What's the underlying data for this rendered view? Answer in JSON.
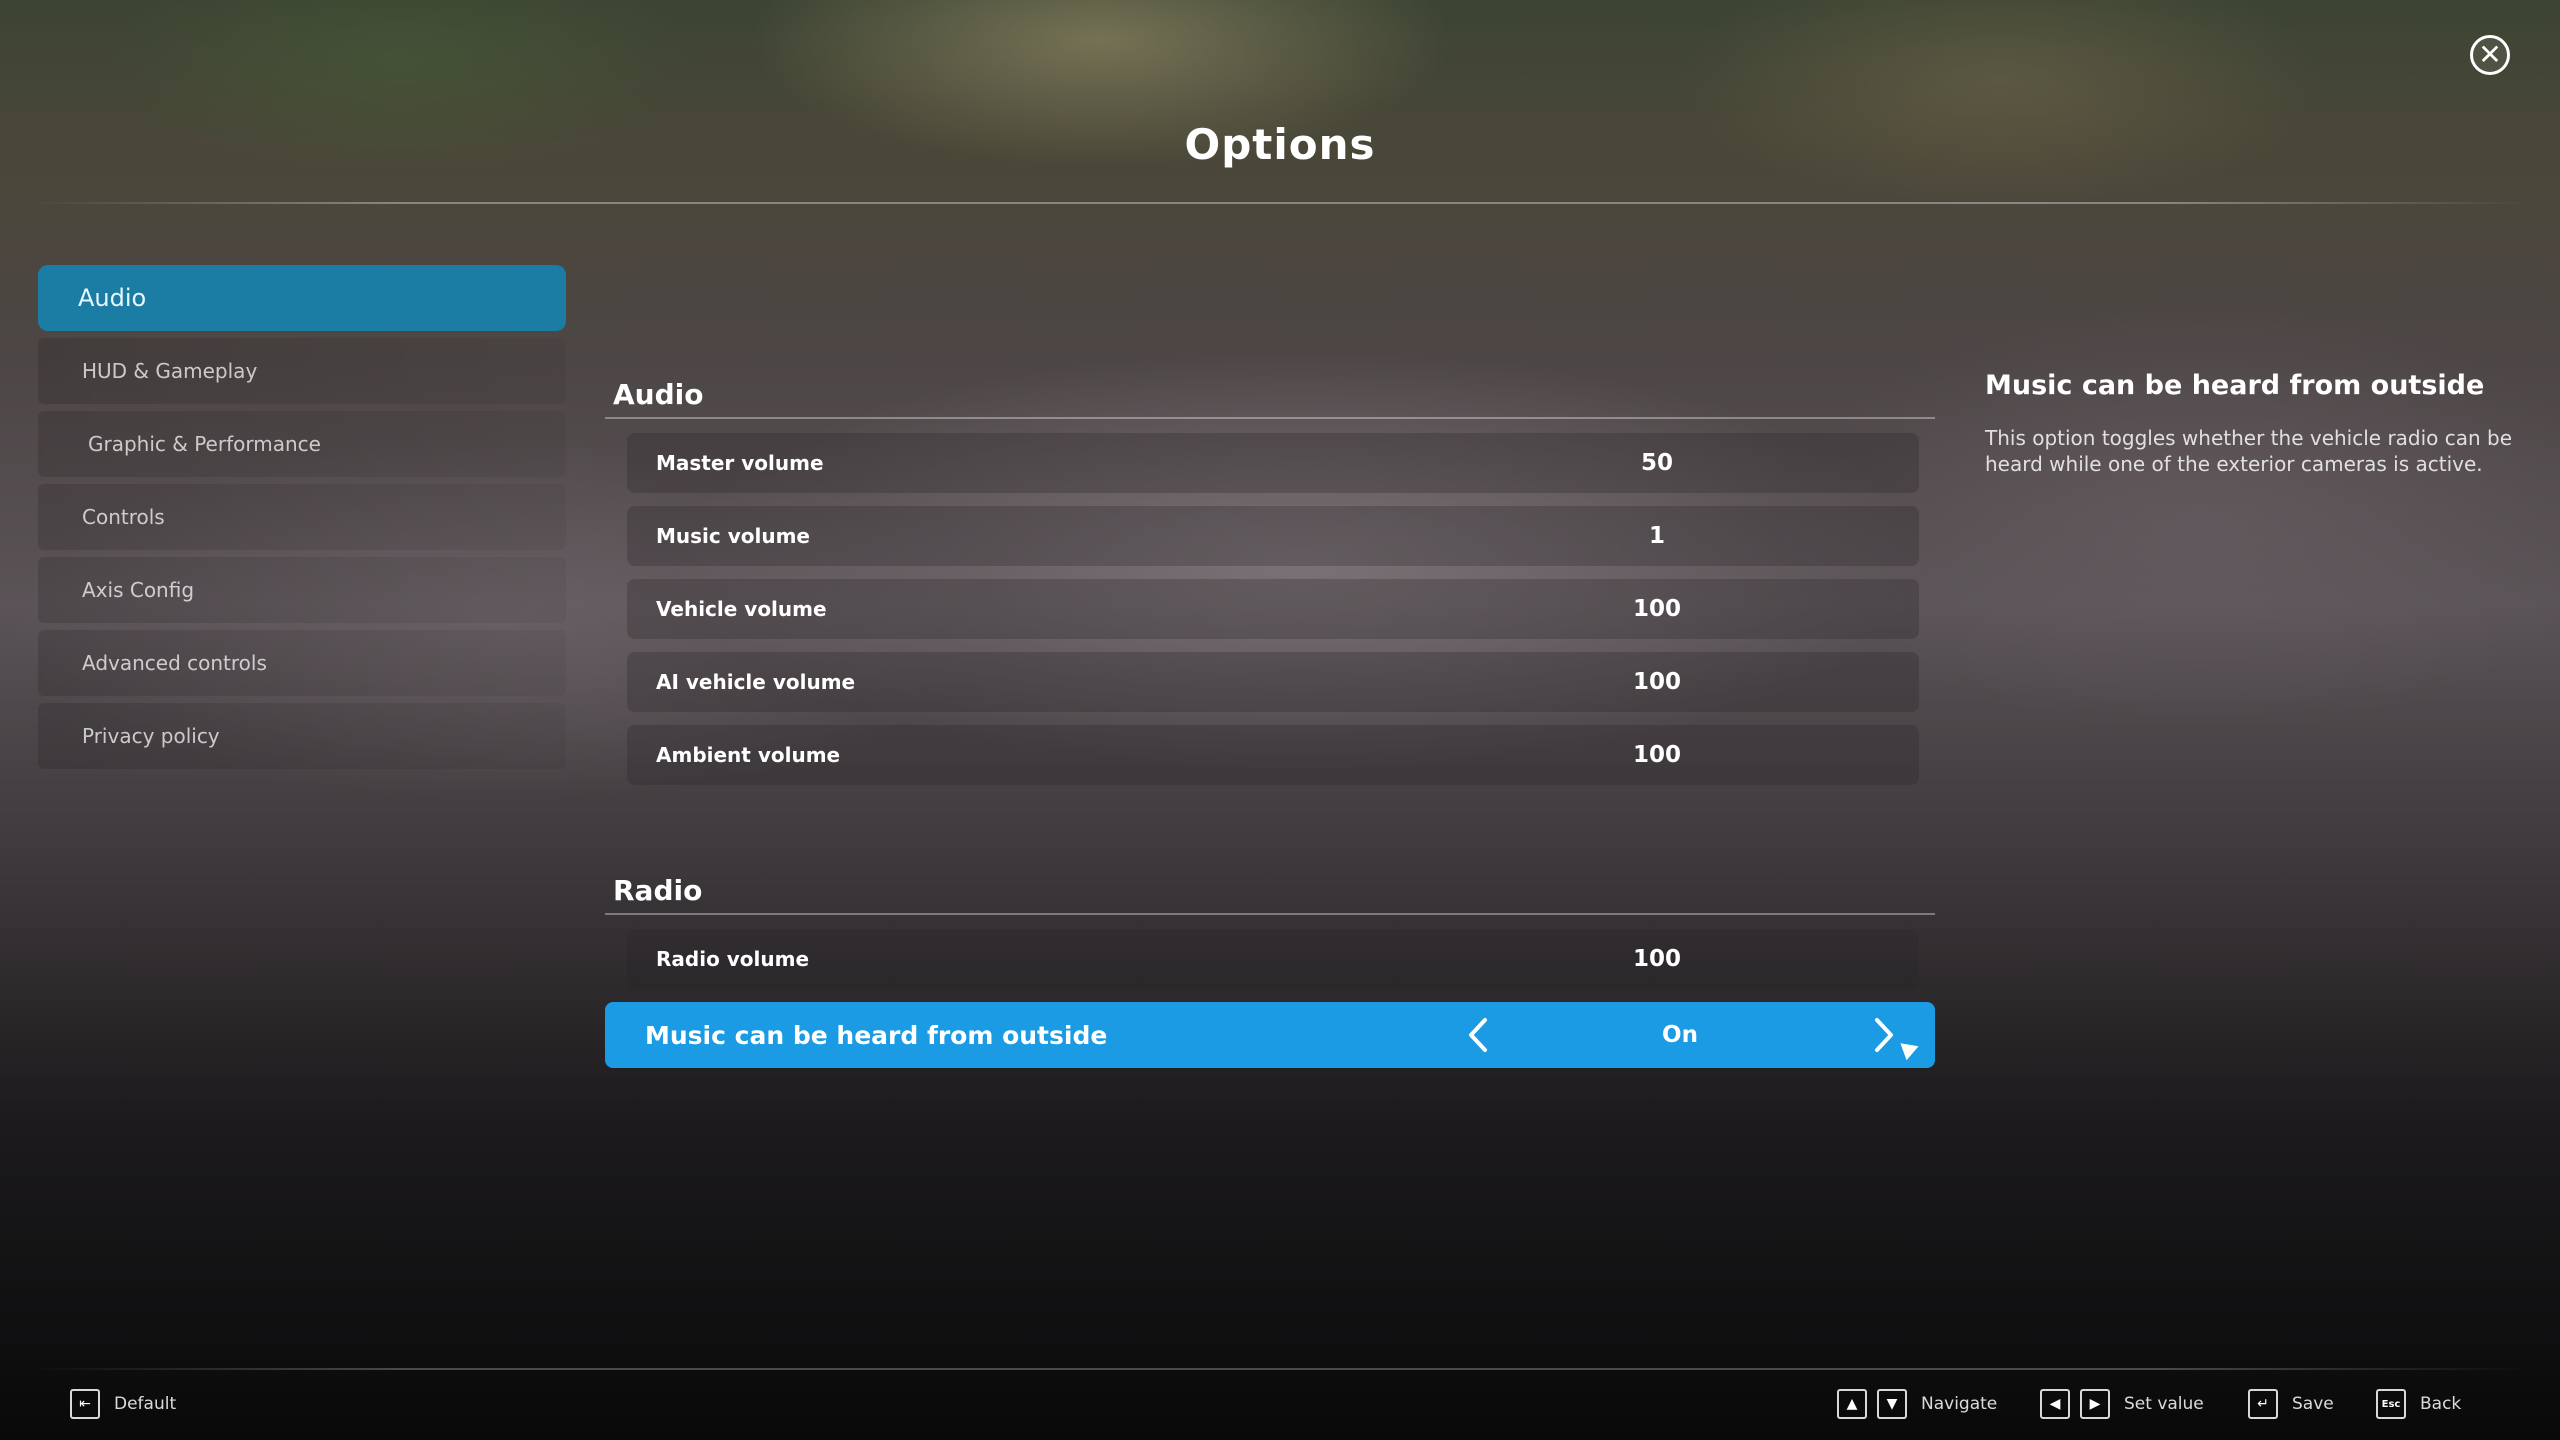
{
  "header": {
    "title": "Options"
  },
  "sidebar": {
    "items": [
      {
        "label": "Audio",
        "active": true
      },
      {
        "label": "HUD & Gameplay"
      },
      {
        "label": "Graphic & Performance"
      },
      {
        "label": "Controls"
      },
      {
        "label": "Axis Config"
      },
      {
        "label": "Advanced controls"
      },
      {
        "label": "Privacy policy"
      }
    ]
  },
  "sections": {
    "audio": {
      "title": "Audio",
      "rows": [
        {
          "label": "Master volume",
          "value": "50"
        },
        {
          "label": "Music volume",
          "value": "1"
        },
        {
          "label": "Vehicle volume",
          "value": "100"
        },
        {
          "label": "AI vehicle volume",
          "value": "100"
        },
        {
          "label": "Ambient volume",
          "value": "100"
        }
      ]
    },
    "radio": {
      "title": "Radio",
      "rows": [
        {
          "label": "Radio volume",
          "value": "100"
        },
        {
          "label": "Music can be heard from outside",
          "value": "On",
          "selected": true
        }
      ]
    }
  },
  "description": {
    "title": "Music can be heard from outside",
    "text": "This option toggles whether the vehicle radio can be heard while one of the exterior cameras is active."
  },
  "footer": {
    "default_label": "Default",
    "navigate_label": "Navigate",
    "set_value_label": "Set value",
    "save_label": "Save",
    "back_key": "Esc",
    "back_label": "Back"
  },
  "colors": {
    "accent": "#1a9be4",
    "sidebar_active": "#1b7da3"
  }
}
